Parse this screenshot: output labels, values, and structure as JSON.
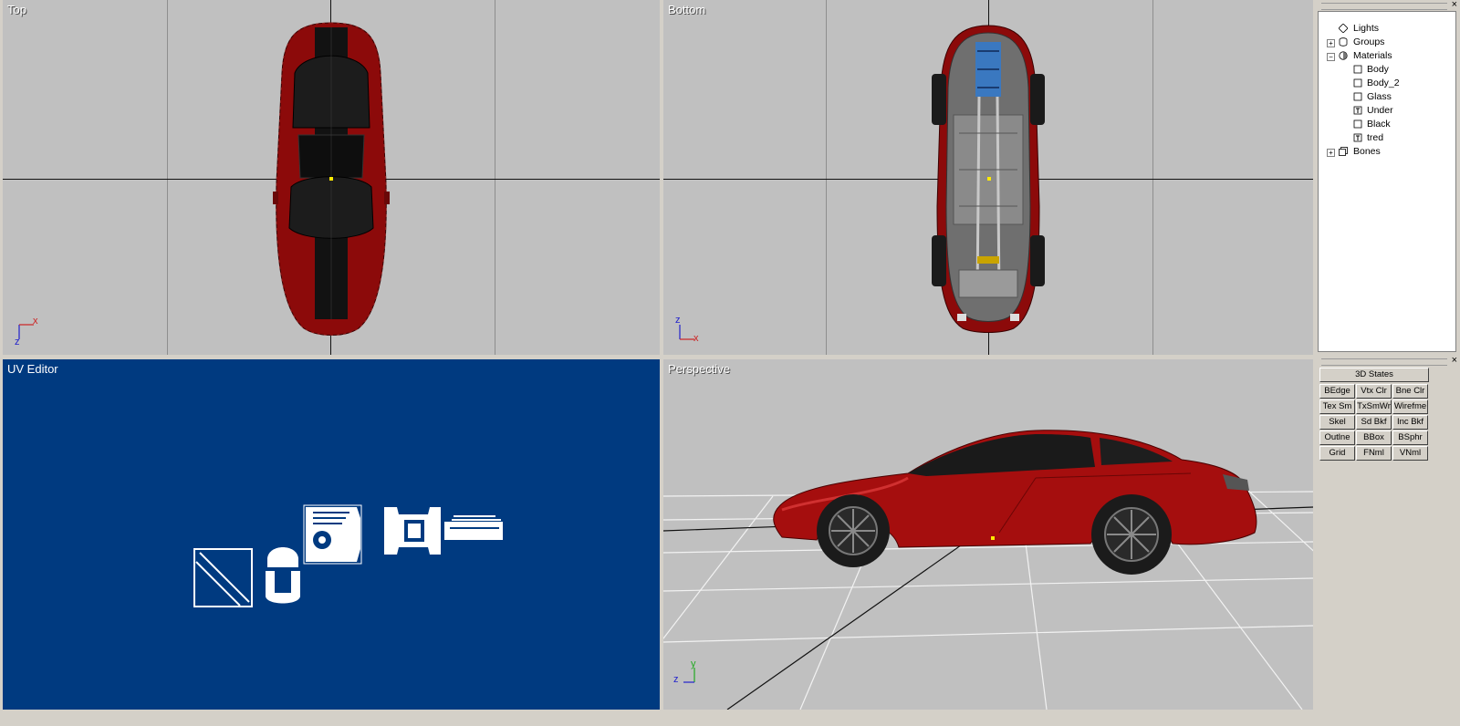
{
  "viewports": {
    "top": {
      "title": "Top"
    },
    "bottom": {
      "title": "Bottom"
    },
    "uv": {
      "title": "UV Editor"
    },
    "perspective": {
      "title": "Perspective"
    }
  },
  "axes": {
    "top": {
      "h": "x",
      "v": "z"
    },
    "bottom": {
      "h": "x",
      "v": "z"
    },
    "perspective": {
      "h": "z",
      "v": "y"
    }
  },
  "tree": {
    "lights": "Lights",
    "groups": "Groups",
    "materials": "Materials",
    "items": [
      "Body",
      "Body_2",
      "Glass",
      "Under",
      "Black",
      "tred"
    ],
    "bones": "Bones",
    "expand": "+",
    "collapse": "−"
  },
  "states": {
    "title": "3D States",
    "buttons": [
      [
        "BEdge",
        "Vtx Clr",
        "Bne Clr"
      ],
      [
        "Tex Sm",
        "TxSmWr",
        "Wirefme"
      ],
      [
        "Skel",
        "Sd Bkf",
        "Inc Bkf"
      ],
      [
        "Outlne",
        "BBox",
        "BSphr"
      ],
      [
        "Grid",
        "FNml",
        "VNml"
      ]
    ]
  },
  "close_glyph": "×",
  "colors": {
    "car_red": "#8c0a0a",
    "uv_bg": "#003a80",
    "viewport_bg": "#c0c0c0",
    "origin": "#ffea00"
  }
}
